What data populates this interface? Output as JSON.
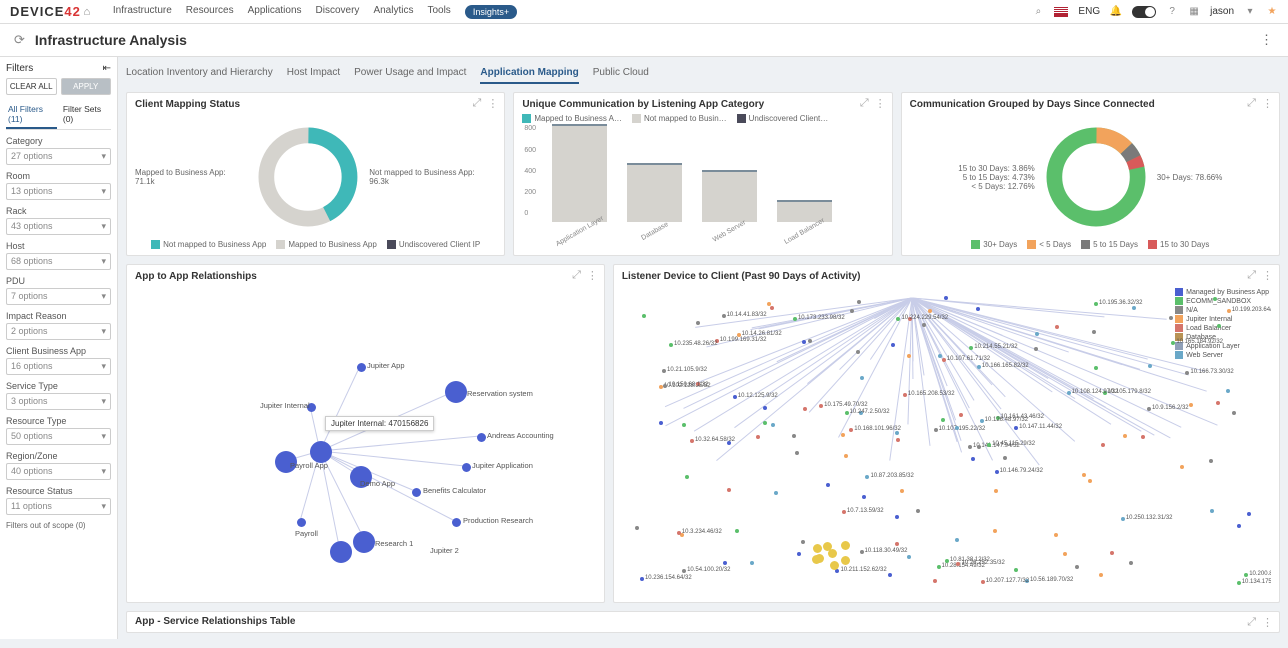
{
  "top": {
    "logo_a": "DEVICE",
    "logo_b": "42",
    "nav": [
      "Infrastructure",
      "Resources",
      "Applications",
      "Discovery",
      "Analytics",
      "Tools"
    ],
    "insights": "Insights+",
    "lang": "ENG",
    "user": "jason"
  },
  "page_title": "Infrastructure Analysis",
  "sidebar": {
    "head": "Filters",
    "clear": "CLEAR ALL",
    "apply": "APPLY",
    "tabs": [
      "All Filters (11)",
      "Filter Sets (0)"
    ],
    "groups": [
      {
        "label": "Category",
        "opt": "27 options"
      },
      {
        "label": "Room",
        "opt": "13 options"
      },
      {
        "label": "Rack",
        "opt": "43 options"
      },
      {
        "label": "Host",
        "opt": "68 options"
      },
      {
        "label": "PDU",
        "opt": "7 options"
      },
      {
        "label": "Impact Reason",
        "opt": "2 options"
      },
      {
        "label": "Client Business App",
        "opt": "16 options"
      },
      {
        "label": "Service Type",
        "opt": "3 options"
      },
      {
        "label": "Resource Type",
        "opt": "50 options"
      },
      {
        "label": "Region/Zone",
        "opt": "40 options"
      },
      {
        "label": "Resource Status",
        "opt": "11 options"
      }
    ],
    "oos": "Filters out of scope (0)"
  },
  "tabs": [
    "Location Inventory and Hierarchy",
    "Host Impact",
    "Power Usage and Impact",
    "Application Mapping",
    "Public Cloud"
  ],
  "active_tab": 3,
  "chart_data": [
    {
      "id": "mapping",
      "type": "pie",
      "title": "Client Mapping Status",
      "series": [
        {
          "name": "Mapped to Business App",
          "value": 71100,
          "label": "Mapped to Business App: 71.1k",
          "color": "#3fb8b8"
        },
        {
          "name": "Not mapped to Business App",
          "value": 96300,
          "label": "Not mapped to Business App: 96.3k",
          "color": "#d5d3ce"
        }
      ],
      "legend": [
        "Not mapped to Business App",
        "Mapped to Business App",
        "Undiscovered Client IP"
      ]
    },
    {
      "id": "unique",
      "type": "bar",
      "title": "Unique Communication by Listening App Category",
      "legend": [
        "Mapped to Business A…",
        "Not mapped to Busin…",
        "Undiscovered Client…"
      ],
      "ylim": [
        0,
        800
      ],
      "yticks": [
        0,
        200,
        400,
        600,
        800
      ],
      "categories": [
        "Application Layer",
        "Database",
        "Web Server",
        "Load Balancer"
      ],
      "values": [
        790,
        480,
        420,
        180
      ]
    },
    {
      "id": "days",
      "type": "pie",
      "title": "Communication Grouped by Days Since Connected",
      "series": [
        {
          "name": "30+ Days",
          "value": 78.66,
          "label": "30+ Days: 78.66%",
          "color": "#5bbf6b"
        },
        {
          "name": "< 5 Days",
          "value": 12.76,
          "label": "< 5 Days: 12.76%",
          "color": "#f2a35c"
        },
        {
          "name": "5 to 15 Days",
          "value": 4.73,
          "label": "5 to 15 Days: 4.73%",
          "color": "#7a7a7a"
        },
        {
          "name": "15 to 30 Days",
          "value": 3.86,
          "label": "15 to 30 Days: 3.86%",
          "color": "#d85a5a"
        }
      ],
      "legend": [
        "30+ Days",
        "< 5 Days",
        "5 to 15 Days",
        "15 to 30 Days"
      ]
    }
  ],
  "card_a2a": {
    "title": "App to App Relationships",
    "tooltip": "Jupiter Internal: 470156826",
    "nodes": [
      "Jupiter App",
      "Jupiter Internal",
      "Reservation system",
      "Andreas Accounting",
      "Jupiter Application",
      "Benefits Calculator",
      "Production Research",
      "Jupiter 2",
      "Research 1",
      "Payroll",
      "Payroll App",
      "Demo App"
    ]
  },
  "card_listener": {
    "title": "Listener Device to Client (Past 90 Days of Activity)",
    "legend": [
      {
        "c": "#4a5fd0",
        "t": "Managed by Business App"
      },
      {
        "c": "#5bbf6b",
        "t": "ECOMM_SANDBOX"
      },
      {
        "c": "#888",
        "t": "N/A"
      },
      {
        "c": "#f2a35c",
        "t": "Jupiter Internal"
      },
      {
        "c": "#d5756b",
        "t": "Load Balancer"
      },
      {
        "c": "#b89355",
        "t": "Database"
      },
      {
        "c": "#8fa0b8",
        "t": "Application Layer"
      },
      {
        "c": "#6aa8c8",
        "t": "Web Server"
      }
    ]
  },
  "card_table": {
    "title": "App - Service Relationships Table"
  }
}
